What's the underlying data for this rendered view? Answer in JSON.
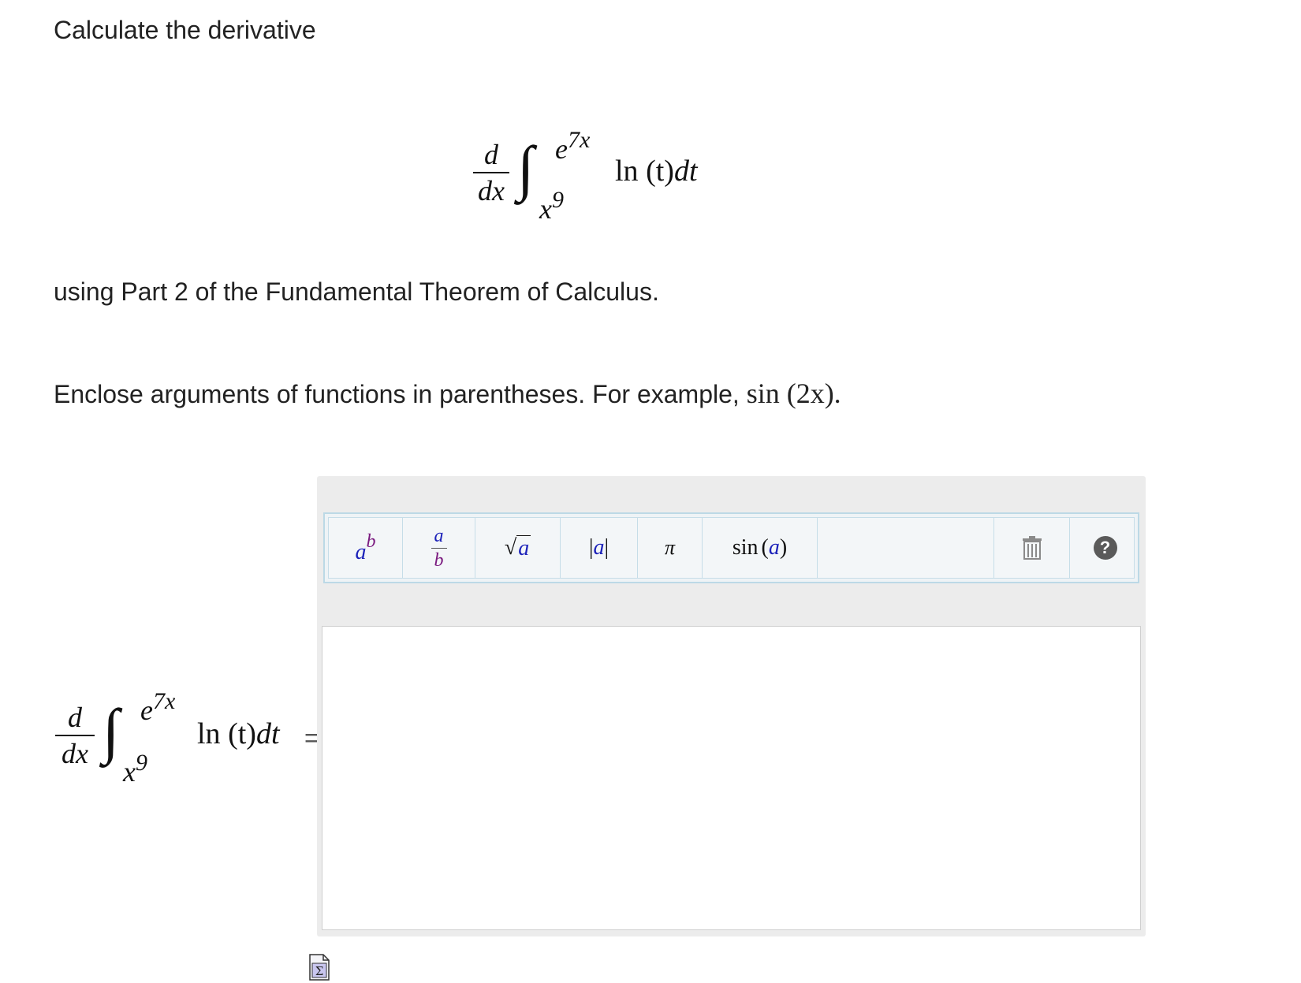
{
  "question": {
    "title": "Calculate the derivative",
    "part_text": "using Part 2 of the Fundamental Theorem of Calculus.",
    "hint_text": "Enclose arguments of functions in parentheses. For example, ",
    "hint_example": "sin (2x).",
    "expression": {
      "d": "d",
      "dx": "dx",
      "upper_base": "e",
      "upper_exp": "7x",
      "lower_base": "x",
      "lower_exp": "9",
      "integrand_fn": "ln",
      "integrand_arg": "(t)",
      "integrand_dt": "dt"
    }
  },
  "answer_prompt": {
    "equals": "="
  },
  "toolbar": {
    "power": {
      "base": "a",
      "exp": "b"
    },
    "fraction": {
      "num": "a",
      "den": "b"
    },
    "sqrt": {
      "radical": "√",
      "arg": "a"
    },
    "abs": {
      "left": "|",
      "arg": "a",
      "right": "|"
    },
    "pi": "π",
    "sin": {
      "fn": "sin",
      "open": "(",
      "arg": "a",
      "close": ")"
    },
    "trash_icon": "trash-icon",
    "help_icon": "help-icon",
    "help_symbol": "?"
  },
  "answer": {
    "value": ""
  },
  "colors": {
    "math_blue": "#1c22b9",
    "math_purple": "#7a1a7f",
    "toolbar_border": "#bcd9e6",
    "widget_bg": "#ececec"
  },
  "icons": {
    "preview": "equation-preview-icon"
  }
}
